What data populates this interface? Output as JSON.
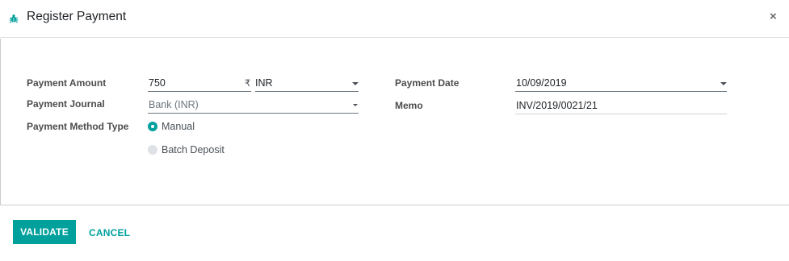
{
  "dialog": {
    "title": "Register Payment",
    "close_glyph": "×",
    "title_icon": "bug-icon"
  },
  "form": {
    "payment_amount": {
      "label": "Payment Amount",
      "value": "750",
      "currency_symbol": "₹",
      "currency": "INR"
    },
    "payment_journal": {
      "label": "Payment Journal",
      "value": "Bank (INR)"
    },
    "payment_method_type": {
      "label": "Payment Method Type",
      "options": [
        {
          "label": "Manual",
          "selected": true
        },
        {
          "label": "Batch Deposit",
          "selected": false
        }
      ]
    },
    "payment_date": {
      "label": "Payment Date",
      "value": "10/09/2019"
    },
    "memo": {
      "label": "Memo",
      "value": "INV/2019/0021/21"
    }
  },
  "footer": {
    "validate_label": "VALIDATE",
    "cancel_label": "CANCEL"
  },
  "colors": {
    "accent": "#00a09d"
  }
}
